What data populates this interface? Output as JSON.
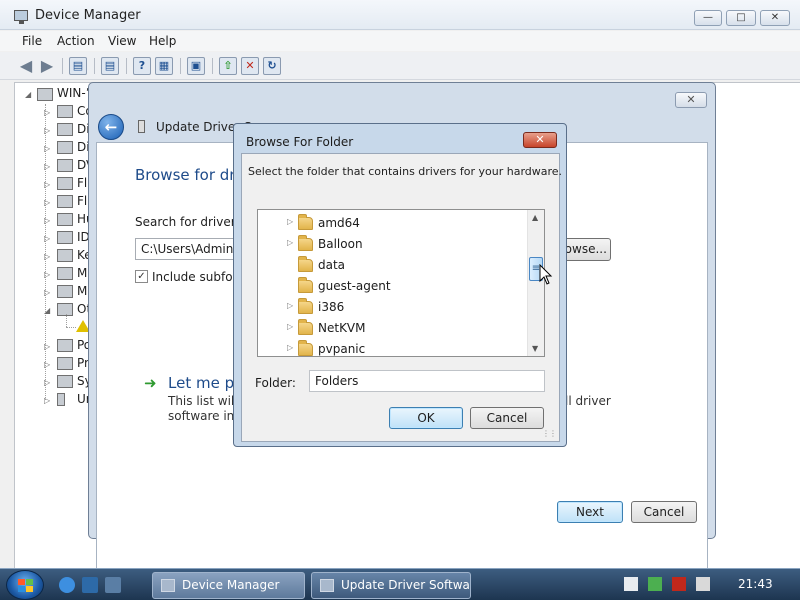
{
  "device_manager": {
    "title": "Device Manager",
    "menu": [
      "File",
      "Action",
      "View",
      "Help"
    ],
    "tree_root": "WIN-’",
    "tree_items": [
      "Co",
      "Di",
      "Di",
      "DV",
      "Fl",
      "Fl",
      "Hu",
      "ID",
      "Ke",
      "M",
      "M",
      "Ot",
      "",
      "Po",
      "Pr",
      "Sy",
      "Ur"
    ]
  },
  "update_driver": {
    "title": "Update Driver So",
    "heading": "Browse for dri",
    "search_label": "Search for driver so",
    "path_value": "C:\\Users\\Adminis",
    "include_subfolders_label": "Include subfold",
    "include_subfolders_checked": true,
    "browse_label": "rowse...",
    "let_me_pick": "Let me pic",
    "desc_line1": "This list will s",
    "desc_line2": "software in t",
    "desc_right1": "ll driver",
    "next_label": "Next",
    "cancel_label": "Cancel",
    "close_label": "✕"
  },
  "browse_folder": {
    "title": "Browse For Folder",
    "close_label": "✕",
    "instruction": "Select the folder that contains drivers for your hardware.",
    "folders": [
      {
        "name": "amd64",
        "expandable": true
      },
      {
        "name": "Balloon",
        "expandable": true
      },
      {
        "name": "data",
        "expandable": false
      },
      {
        "name": "guest-agent",
        "expandable": false
      },
      {
        "name": "i386",
        "expandable": true
      },
      {
        "name": "NetKVM",
        "expandable": true
      },
      {
        "name": "pvpanic",
        "expandable": true
      }
    ],
    "folder_label": "Folder:",
    "folder_value": "Folders",
    "ok_label": "OK",
    "cancel_label": "Cancel"
  },
  "taskbar": {
    "tasks": [
      "Device Manager",
      "Update Driver Softwa..."
    ],
    "clock": "21:43"
  }
}
